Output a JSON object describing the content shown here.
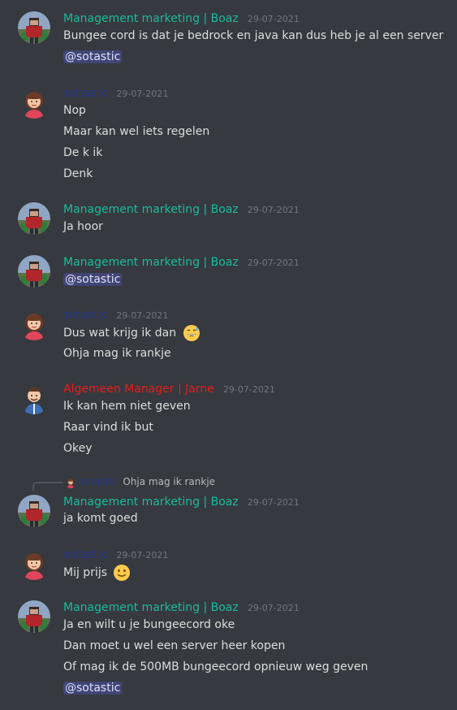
{
  "colors": {
    "background": "#36393f",
    "boaz_color": "#1abc9c",
    "sotastic_color": "#25388b",
    "jarne_color": "#e71c1c",
    "timestamp_color": "#72767d"
  },
  "messages": [
    {
      "author": "Management marketing | Boaz",
      "timestamp": "29-07-2021",
      "lines": [
        "Bungee cord is dat je bedrock en java kan dus heb je al een server"
      ],
      "mention": "@sotastic"
    },
    {
      "author": "sotastic",
      "timestamp": "29-07-2021",
      "lines": [
        "Nop",
        "Maar kan wel iets regelen",
        "De k ik",
        "Denk"
      ]
    },
    {
      "author": "Management marketing | Boaz",
      "timestamp": "29-07-2021",
      "lines": [
        "Ja hoor"
      ]
    },
    {
      "author": "Management marketing | Boaz",
      "timestamp": "29-07-2021",
      "mention": "@sotastic"
    },
    {
      "author": "sotastic",
      "timestamp": "29-07-2021",
      "lines": [
        "Dus wat krijg ik dan",
        "Ohja mag ik rankje"
      ],
      "emoji": "sweat-smile-emoji"
    },
    {
      "author": "Algemeen Manager | Jarne",
      "timestamp": "29-07-2021",
      "lines": [
        "Ik kan hem niet geven",
        "Raar vind ik but",
        "Okey"
      ]
    },
    {
      "reply": {
        "author": "sotastic",
        "text": "Ohja mag ik rankje"
      },
      "author": "Management marketing | Boaz",
      "timestamp": "29-07-2021",
      "lines": [
        "ja komt goed"
      ]
    },
    {
      "author": "sotastic",
      "timestamp": "29-07-2021",
      "lines": [
        "Mij prijs"
      ],
      "emoji": "slight-smile-emoji"
    },
    {
      "author": "Management marketing | Boaz",
      "timestamp": "29-07-2021",
      "lines": [
        "Ja en wilt u je bungeecord oke",
        "Dan moet u wel een server heer kopen",
        "Of mag ik de 500MB bungeecord opnieuw weg geven"
      ],
      "mention": "@sotastic"
    }
  ]
}
